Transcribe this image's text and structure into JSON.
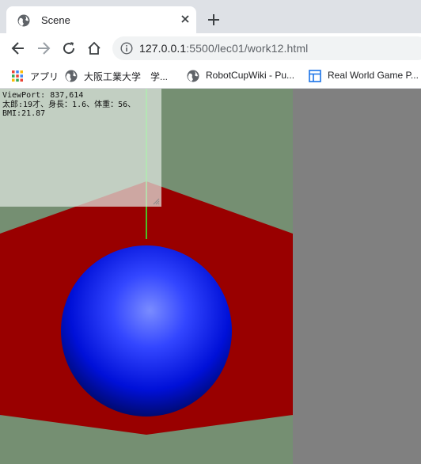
{
  "tab": {
    "title": "Scene",
    "favicon": "globe-icon",
    "close_icon": "close-icon"
  },
  "new_tab_icon": "plus-icon",
  "toolbar": {
    "back_icon": "arrow-left-icon",
    "forward_icon": "arrow-right-icon",
    "reload_icon": "reload-icon",
    "home_icon": "home-icon",
    "info_icon": "info-icon",
    "url_host": "127.0.0.1",
    "url_path": ":5500/lec01/work12.html"
  },
  "bookmarks": [
    {
      "label": "アプリ",
      "icon": "apps-grid-icon"
    },
    {
      "label": "大阪工業大学　学...",
      "icon": "globe-icon"
    },
    {
      "label": "RobotCupWiki - Pu...",
      "icon": "globe-icon"
    },
    {
      "label": "Real World Game P...",
      "icon": "page-layout-icon"
    }
  ],
  "overlay": {
    "viewport_line": "ViewPort: 837,614",
    "person_line": "太郎:19才、身長：1.6、体重：56、",
    "bmi_line": "BMI:21.87"
  },
  "colors": {
    "scene_background": "#758f72",
    "floor": "#990000",
    "sphere": "#0000ff",
    "axis_x": "#ff3333",
    "axis_y": "#33ff33",
    "axis_z": "#3333ff",
    "outside_viewport": "#808080"
  }
}
